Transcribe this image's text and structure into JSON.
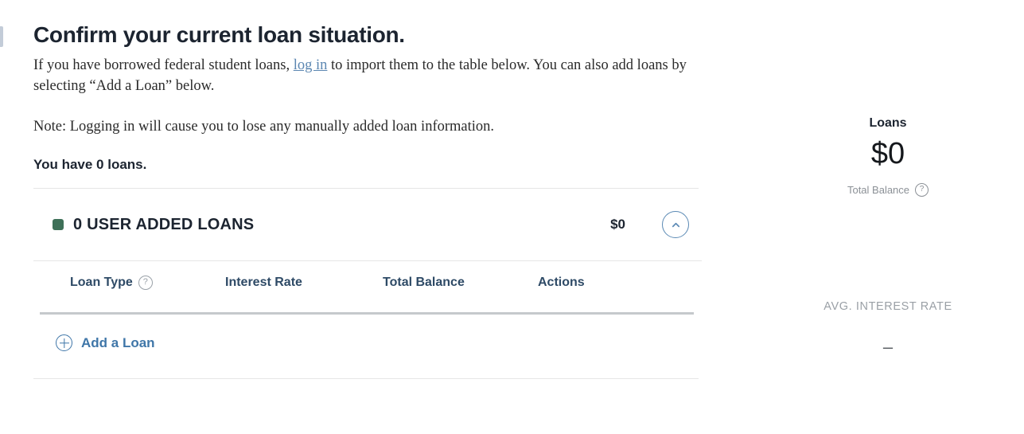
{
  "heading": "Confirm your current loan situation.",
  "intro": {
    "before_link": "If you have borrowed federal student loans, ",
    "link_text": "log in",
    "after_link": " to import them to the table below. You can also add loans by selecting “Add a Loan” below."
  },
  "note": "Note: Logging in will cause you to lose any manually added loan information.",
  "loan_count_text": "You have 0 loans.",
  "group": {
    "label": "0 USER ADDED LOANS",
    "amount": "$0",
    "swatch_color": "#3e7058",
    "toggle_icon": "chevron-up-icon"
  },
  "table": {
    "columns": [
      {
        "label": "Loan Type",
        "has_help": true
      },
      {
        "label": "Interest Rate",
        "has_help": false
      },
      {
        "label": "Total Balance",
        "has_help": false
      },
      {
        "label": "Actions",
        "has_help": false
      }
    ],
    "help_glyph": "?",
    "rows": []
  },
  "add_loan": {
    "label": "Add a Loan",
    "icon": "plus-circle-icon",
    "color": "#3f76a8"
  },
  "summary": {
    "title": "Loans",
    "value": "$0",
    "sub_label": "Total Balance",
    "help_glyph": "?",
    "rate_label": "AVG. INTEREST RATE",
    "rate_value": "–"
  },
  "colors": {
    "link": "#5c87b2",
    "accent_blue": "#3f76a8",
    "heading": "#1c2430",
    "table_header": "#2e4a66",
    "muted": "#9aa0a6"
  }
}
